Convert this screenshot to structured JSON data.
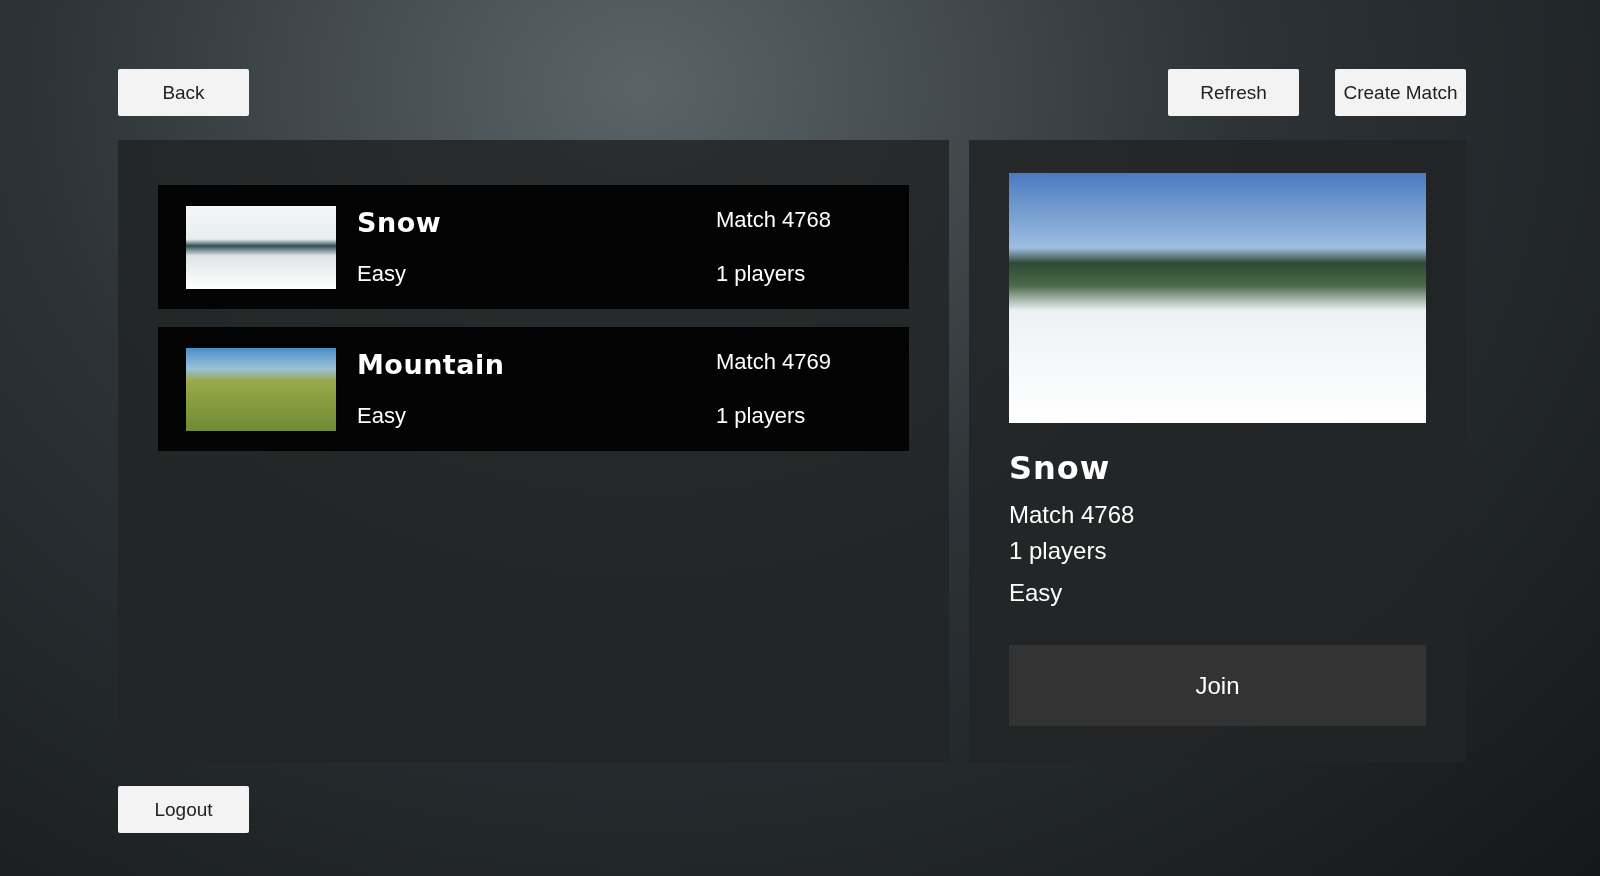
{
  "top_bar": {
    "back": "Back",
    "refresh": "Refresh",
    "create": "Create Match"
  },
  "matches": [
    {
      "map": "Snow",
      "match": "Match 4768",
      "difficulty": "Easy",
      "players": "1 players",
      "kind": "snow"
    },
    {
      "map": "Mountain",
      "match": "Match 4769",
      "difficulty": "Easy",
      "players": "1 players",
      "kind": "mountain"
    }
  ],
  "details": {
    "map": "Snow",
    "match": "Match 4768",
    "players": "1 players",
    "difficulty": "Easy",
    "join": "Join"
  },
  "logout": "Logout"
}
